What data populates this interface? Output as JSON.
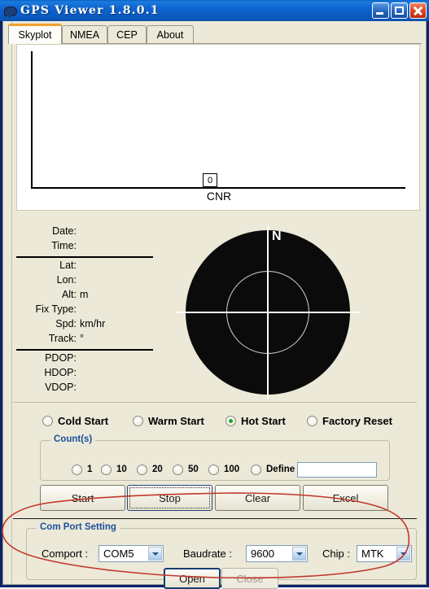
{
  "window": {
    "title": "GPS Viewer 1.8.0.1",
    "icon": "app-chat-icon",
    "buttons": {
      "minimize": "minimize",
      "maximize": "maximize",
      "close": "close"
    }
  },
  "tabs": [
    {
      "label": "Skyplot",
      "active": true
    },
    {
      "label": "NMEA",
      "active": false
    },
    {
      "label": "CEP",
      "active": false
    },
    {
      "label": "About",
      "active": false
    }
  ],
  "chart_data": {
    "type": "bar",
    "title": "",
    "xlabel": "CNR",
    "ylabel": "",
    "categories": [
      "0"
    ],
    "values": [
      0
    ],
    "annotations": [
      "0"
    ],
    "grid": false,
    "legend": "none",
    "axis_color": "#000000",
    "background": "#ffffff"
  },
  "info": {
    "rows": [
      {
        "key": "Date:",
        "value": ""
      },
      {
        "key": "Time:",
        "value": ""
      },
      {
        "key": "Lat:",
        "value": ""
      },
      {
        "key": "Lon:",
        "value": ""
      },
      {
        "key": "Alt:",
        "value": "m"
      },
      {
        "key": "Fix Type:",
        "value": ""
      },
      {
        "key": "Spd:",
        "value": "km/hr"
      },
      {
        "key": "Track:",
        "value": "°"
      },
      {
        "key": "PDOP:",
        "value": ""
      },
      {
        "key": "HDOP:",
        "value": ""
      },
      {
        "key": "VDOP:",
        "value": ""
      }
    ]
  },
  "skyplot": {
    "north_label": "N",
    "disc_color": "#0b0b0b",
    "line_color": "#ffffff",
    "ring_color": "#d6d6d6"
  },
  "start_modes": [
    {
      "label": "Cold Start",
      "selected": false
    },
    {
      "label": "Warm Start",
      "selected": false
    },
    {
      "label": "Hot Start",
      "selected": true
    },
    {
      "label": "Factory Reset",
      "selected": false
    }
  ],
  "counts": {
    "group_label": "Count(s)",
    "options": [
      {
        "label": "1",
        "selected": false
      },
      {
        "label": "10",
        "selected": false
      },
      {
        "label": "20",
        "selected": false
      },
      {
        "label": "50",
        "selected": false
      },
      {
        "label": "100",
        "selected": false
      },
      {
        "label": "Define",
        "selected": false
      }
    ],
    "define_value": "",
    "define_placeholder": ""
  },
  "actions": {
    "start": "Start",
    "stop": "Stop",
    "clear": "Clear",
    "excel": "Excel"
  },
  "com_port": {
    "group_label": "Com Port Setting",
    "comport_label": "Comport :",
    "comport_value": "COM5",
    "baudrate_label": "Baudrate :",
    "baudrate_value": "9600",
    "chip_label": "Chip :",
    "chip_value": "MTK",
    "open_label": "Open",
    "close_label": "Close",
    "open_enabled": true,
    "close_enabled": false
  },
  "annotation": {
    "color": "#c0392b",
    "shape": "hand-drawn-ellipse"
  }
}
